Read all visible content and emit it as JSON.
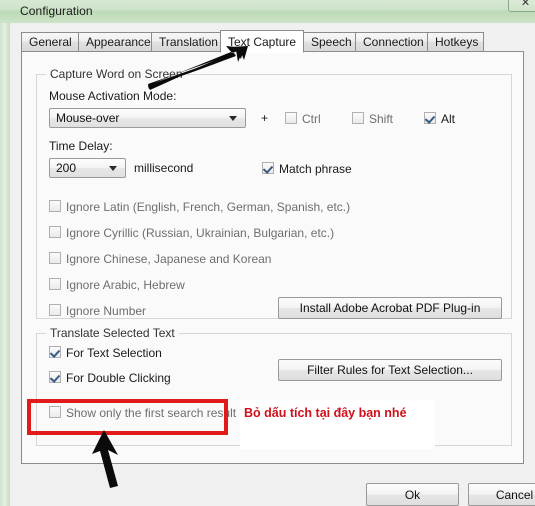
{
  "window": {
    "title": "Configuration",
    "close_label": "✕"
  },
  "tabs": [
    {
      "label": "General",
      "active": false
    },
    {
      "label": "Appearance",
      "active": false
    },
    {
      "label": "Translation",
      "active": false
    },
    {
      "label": "Text Capture",
      "active": true
    },
    {
      "label": "Speech",
      "active": false
    },
    {
      "label": "Connection",
      "active": false
    },
    {
      "label": "Hotkeys",
      "active": false
    }
  ],
  "capture_group": {
    "title": "Capture Word on Screen",
    "mouse_mode_label": "Mouse Activation Mode:",
    "mouse_mode_value": "Mouse-over",
    "plus_sign": "+",
    "modifiers": [
      {
        "label": "Ctrl",
        "checked": false
      },
      {
        "label": "Shift",
        "checked": false
      },
      {
        "label": "Alt",
        "checked": true
      }
    ],
    "time_delay_label": "Time Delay:",
    "time_delay_value": "200",
    "time_delay_unit": "millisecond",
    "match_phrase": {
      "label": "Match phrase",
      "checked": true
    },
    "ignore_options": [
      {
        "label": "Ignore Latin (English, French, German, Spanish, etc.)",
        "checked": false
      },
      {
        "label": "Ignore Cyrillic (Russian, Ukrainian, Bulgarian, etc.)",
        "checked": false
      },
      {
        "label": "Ignore Chinese, Japanese and Korean",
        "checked": false
      },
      {
        "label": "Ignore Arabic, Hebrew",
        "checked": false
      },
      {
        "label": "Ignore Number",
        "checked": false
      }
    ],
    "install_button": "Install Adobe Acrobat PDF Plug-in"
  },
  "translate_group": {
    "title": "Translate Selected Text",
    "options": [
      {
        "label": "For Text Selection",
        "checked": true
      },
      {
        "label": "For Double Clicking",
        "checked": true
      }
    ],
    "filter_button": "Filter Rules for Text Selection...",
    "first_result": {
      "label": "Show only the first search result",
      "checked": false
    }
  },
  "annotation": {
    "note_text": "Bỏ dấu tích tại đây bạn nhé",
    "highlight_color": "#e01b1b",
    "note_color": "#d0101a"
  },
  "footer": {
    "ok_label": "Ok",
    "cancel_label": "Cancel"
  }
}
